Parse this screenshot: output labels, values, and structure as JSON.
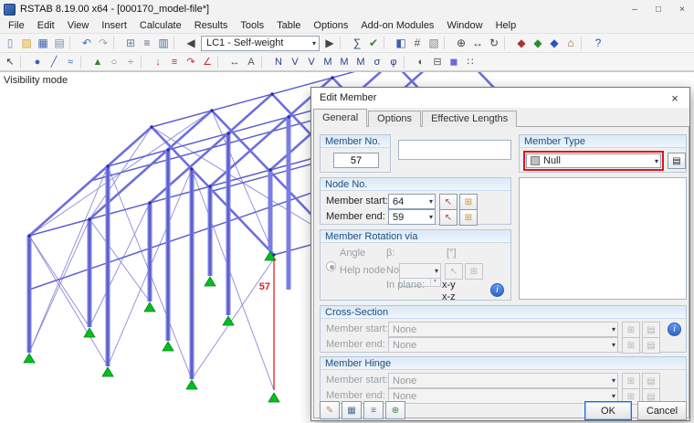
{
  "window": {
    "title": "RSTAB 8.19.00 x64 - [000170_model-file*]",
    "minimize": "–",
    "maximize": "□",
    "close": "×"
  },
  "menu": {
    "items": [
      {
        "name": "menu-file",
        "label": "File"
      },
      {
        "name": "menu-edit",
        "label": "Edit"
      },
      {
        "name": "menu-view",
        "label": "View"
      },
      {
        "name": "menu-insert",
        "label": "Insert"
      },
      {
        "name": "menu-calculate",
        "label": "Calculate"
      },
      {
        "name": "menu-results",
        "label": "Results"
      },
      {
        "name": "menu-tools",
        "label": "Tools"
      },
      {
        "name": "menu-table",
        "label": "Table"
      },
      {
        "name": "menu-options",
        "label": "Options"
      },
      {
        "name": "menu-addon-modules",
        "label": "Add-on Modules"
      },
      {
        "name": "menu-window",
        "label": "Window"
      },
      {
        "name": "menu-help",
        "label": "Help"
      }
    ]
  },
  "toolbar1": {
    "lc_value": "LC1 - Self-weight",
    "icons_left": [
      {
        "name": "new-file-icon",
        "glyph": "▯",
        "color": "#6b84a8"
      },
      {
        "name": "open-file-icon",
        "glyph": "▨",
        "color": "#d9a62e"
      },
      {
        "name": "save-icon",
        "glyph": "▦",
        "color": "#3f5fa8"
      },
      {
        "name": "print-icon",
        "glyph": "▤",
        "color": "#7d8da0"
      },
      {
        "name": "separator",
        "glyph": "",
        "color": "#d6d6d6"
      },
      {
        "name": "undo-icon",
        "glyph": "↶",
        "color": "#3a6cd4"
      },
      {
        "name": "redo-icon",
        "glyph": "↷",
        "color": "#9aa8ba"
      },
      {
        "name": "separator",
        "glyph": "",
        "color": "#d6d6d6"
      },
      {
        "name": "tables-icon",
        "glyph": "⊞",
        "color": "#6e84a0"
      },
      {
        "name": "navigator-icon",
        "glyph": "≡",
        "color": "#55657a"
      },
      {
        "name": "panel-icon",
        "glyph": "▥",
        "color": "#4a6a9a"
      },
      {
        "name": "separator",
        "glyph": "",
        "color": "#d6d6d6"
      },
      {
        "name": "previous-load-case-icon",
        "glyph": "◀",
        "color": "#444444"
      }
    ],
    "icons_right": [
      {
        "name": "next-load-case-icon",
        "glyph": "▶",
        "color": "#444444"
      },
      {
        "name": "separator",
        "glyph": "",
        "color": "#d6d6d6"
      },
      {
        "name": "calculate-icon",
        "glyph": "∑",
        "color": "#27408b"
      },
      {
        "name": "check-model-icon",
        "glyph": "✔",
        "color": "#2e8b2e"
      },
      {
        "name": "separator",
        "glyph": "",
        "color": "#d6d6d6"
      },
      {
        "name": "show-results-icon",
        "glyph": "◧",
        "color": "#3a5fae"
      },
      {
        "name": "result-values-icon",
        "glyph": "#",
        "color": "#555555"
      },
      {
        "name": "panel-toggle-icon",
        "glyph": "▧",
        "color": "#808890"
      },
      {
        "name": "separator",
        "glyph": "",
        "color": "#d6d6d6"
      },
      {
        "name": "zoom-icon",
        "glyph": "⊕",
        "color": "#444444"
      },
      {
        "name": "move-view-icon",
        "glyph": "↔",
        "color": "#444444"
      },
      {
        "name": "rotate-view-icon",
        "glyph": "↻",
        "color": "#444444"
      },
      {
        "name": "separator",
        "glyph": "",
        "color": "#d6d6d6"
      },
      {
        "name": "view-x-icon",
        "glyph": "◆",
        "color": "#b03030"
      },
      {
        "name": "view-y-icon",
        "glyph": "◆",
        "color": "#2e8b2e"
      },
      {
        "name": "view-z-icon",
        "glyph": "◆",
        "color": "#2a52be"
      },
      {
        "name": "isometric-view-icon",
        "glyph": "⌂",
        "color": "#8a6a2a"
      },
      {
        "name": "separator",
        "glyph": "",
        "color": "#d6d6d6"
      },
      {
        "name": "help-icon",
        "glyph": "?",
        "color": "#2a52be"
      }
    ]
  },
  "toolbar2": {
    "icons": [
      {
        "name": "pointer-icon",
        "glyph": "↖",
        "color": "#333333"
      },
      {
        "name": "separator",
        "glyph": "",
        "color": "#d6d6d6"
      },
      {
        "name": "new-node-icon",
        "glyph": "●",
        "color": "#3a5fae"
      },
      {
        "name": "new-member-icon",
        "glyph": "╱",
        "color": "#3a5fae"
      },
      {
        "name": "new-member-set-icon",
        "glyph": "≈",
        "color": "#3a5fae"
      },
      {
        "name": "separator",
        "glyph": "",
        "color": "#d6d6d6"
      },
      {
        "name": "support-icon",
        "glyph": "▲",
        "color": "#2e8b2e"
      },
      {
        "name": "hinge-icon",
        "glyph": "○",
        "color": "#707070"
      },
      {
        "name": "divide-member-icon",
        "glyph": "÷",
        "color": "#707070"
      },
      {
        "name": "separator",
        "glyph": "",
        "color": "#d6d6d6"
      },
      {
        "name": "nodal-load-icon",
        "glyph": "↓",
        "color": "#c03030"
      },
      {
        "name": "member-load-icon",
        "glyph": "≡",
        "color": "#c03030"
      },
      {
        "name": "moment-load-icon",
        "glyph": "↷",
        "color": "#c03030"
      },
      {
        "name": "imperfection-icon",
        "glyph": "∠",
        "color": "#c03030"
      },
      {
        "name": "separator",
        "glyph": "",
        "color": "#d6d6d6"
      },
      {
        "name": "dimension-icon",
        "glyph": "↔",
        "color": "#555555"
      },
      {
        "name": "comment-icon",
        "glyph": "A",
        "color": "#555555"
      },
      {
        "name": "separator",
        "glyph": "",
        "color": "#d6d6d6"
      },
      {
        "name": "result-n-icon",
        "glyph": "N",
        "color": "#27408b"
      },
      {
        "name": "result-vy-icon",
        "glyph": "V",
        "color": "#27408b"
      },
      {
        "name": "result-vz-icon",
        "glyph": "V",
        "color": "#27408b"
      },
      {
        "name": "result-mt-icon",
        "glyph": "M",
        "color": "#27408b"
      },
      {
        "name": "result-my-icon",
        "glyph": "M",
        "color": "#27408b"
      },
      {
        "name": "result-mz-icon",
        "glyph": "M",
        "color": "#27408b"
      },
      {
        "name": "result-sigma-icon",
        "glyph": "σ",
        "color": "#27408b"
      },
      {
        "name": "result-phi-icon",
        "glyph": "φ",
        "color": "#27408b"
      },
      {
        "name": "separator",
        "glyph": "",
        "color": "#d6d6d6"
      },
      {
        "name": "visibility-icon",
        "glyph": "◐",
        "color": "#555555"
      },
      {
        "name": "clipping-icon",
        "glyph": "⊟",
        "color": "#555555"
      },
      {
        "name": "rendering-icon",
        "glyph": "◼",
        "color": "#6a6ade"
      },
      {
        "name": "grid-icon",
        "glyph": "∷",
        "color": "#555555"
      }
    ]
  },
  "canvas": {
    "visibility_label": "Visibility mode",
    "selected_member_label": "57"
  },
  "dialog": {
    "title": "Edit Member",
    "close": "×",
    "tabs": [
      {
        "name": "tab-general",
        "label": "General"
      },
      {
        "name": "tab-options",
        "label": "Options"
      },
      {
        "name": "tab-effective-lengths",
        "label": "Effective Lengths"
      }
    ],
    "member_no": {
      "header": "Member No.",
      "value": "57"
    },
    "member_type": {
      "header": "Member Type",
      "value": "Null"
    },
    "node_no": {
      "header": "Node No.",
      "start_label": "Member start:",
      "start_value": "64",
      "end_label": "Member end:",
      "end_value": "59"
    },
    "rotation": {
      "header": "Member Rotation via",
      "angle_label": "Angle",
      "beta_label": "β:",
      "unit": "[°]",
      "help_label": "Help node",
      "no_label": "No.:",
      "in_plane_label": "In plane:",
      "xy_label": "x-y",
      "xz_label": "x-z",
      "info": "i"
    },
    "cross_section": {
      "header": "Cross-Section",
      "start_label": "Member start:",
      "start_value": "None",
      "end_label": "Member end:",
      "end_value": "None",
      "info": "i"
    },
    "member_hinge": {
      "header": "Member Hinge",
      "start_label": "Member start:",
      "start_value": "None",
      "end_label": "Member end:",
      "end_value": "None"
    },
    "footer": {
      "ok": "OK",
      "cancel": "Cancel"
    }
  }
}
